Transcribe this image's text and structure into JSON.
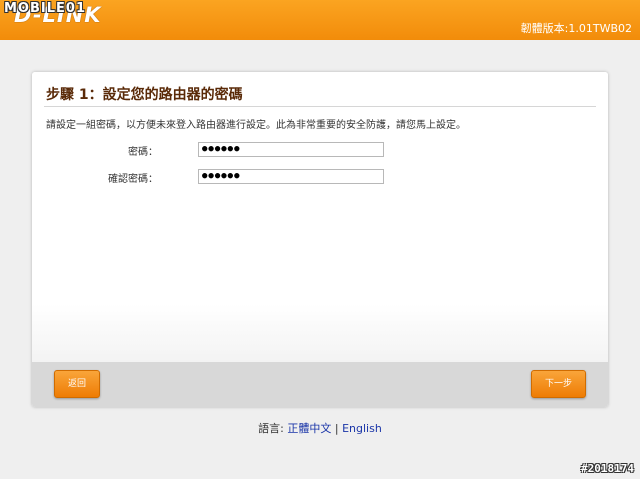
{
  "header": {
    "logo_text": "D-LINK",
    "watermark": "MOBILE01",
    "firmware_label": "韌體版本:1.01TWB02"
  },
  "wizard": {
    "step_title": "步驟 1：設定您的路由器的密碼",
    "description": "請設定一組密碼，以方便未來登入路由器進行設定。此為非常重要的安全防護，請您馬上設定。",
    "password_label": "密碼：",
    "password_value": "●●●●●●",
    "confirm_label": "確認密碼：",
    "confirm_value": "●●●●●●",
    "back_button": "返回",
    "next_button": "下一步"
  },
  "footer": {
    "language_label": "語言:",
    "lang_chinese": "正體中文",
    "separator": "|",
    "lang_english": "English"
  },
  "image_id": "#2018174",
  "colors": {
    "header_orange": "#f7981a",
    "title_brown": "#5a2a08",
    "button_orange": "#f28c0a",
    "link_blue": "#1a35a8"
  }
}
